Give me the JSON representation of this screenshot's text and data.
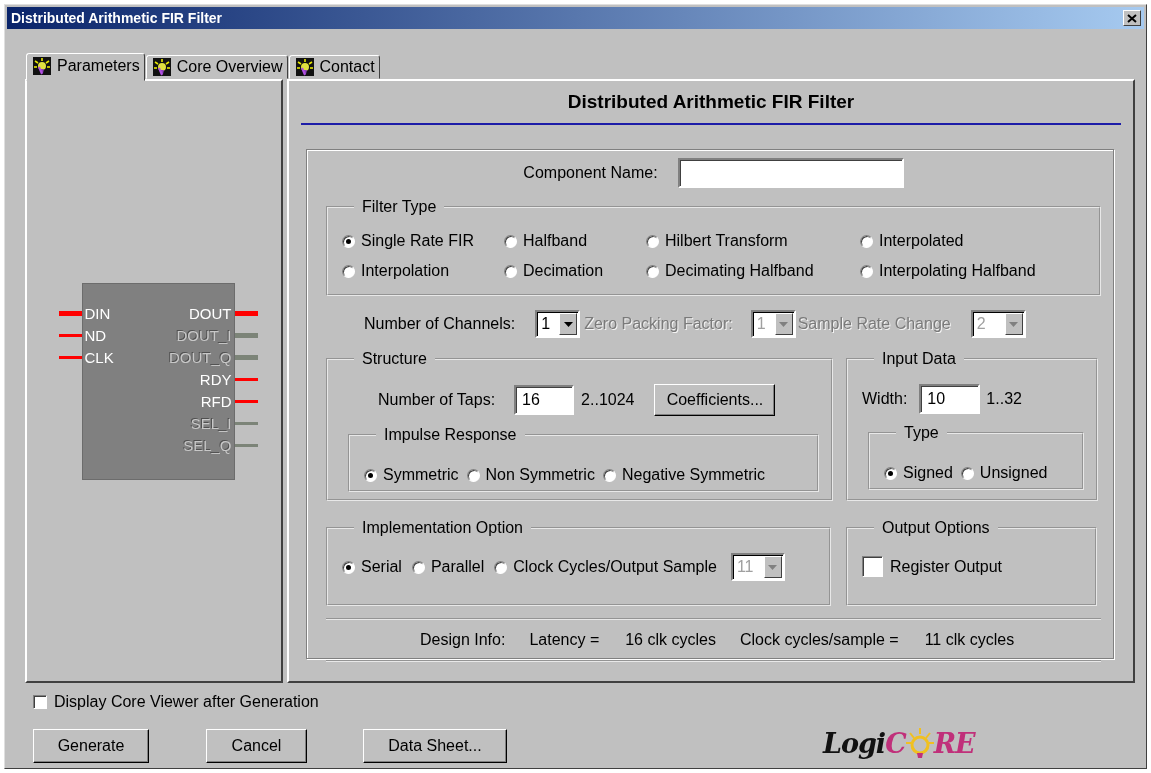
{
  "window": {
    "title": "Distributed Arithmetic FIR Filter"
  },
  "tabs": [
    {
      "label": "Parameters",
      "selected": true
    },
    {
      "label": "Core Overview",
      "selected": false
    },
    {
      "label": "Contact",
      "selected": false
    }
  ],
  "symbol": {
    "inputs": [
      {
        "name": "DIN",
        "enabled": true,
        "bus": true
      },
      {
        "name": "ND",
        "enabled": true,
        "bus": false
      },
      {
        "name": "CLK",
        "enabled": true,
        "bus": false
      }
    ],
    "outputs": [
      {
        "name": "DOUT",
        "enabled": true,
        "bus": true
      },
      {
        "name": "DOUT_I",
        "enabled": false,
        "bus": true
      },
      {
        "name": "DOUT_Q",
        "enabled": false,
        "bus": true
      },
      {
        "name": "RDY",
        "enabled": true,
        "bus": false
      },
      {
        "name": "RFD",
        "enabled": true,
        "bus": false
      },
      {
        "name": "SEL_I",
        "enabled": false,
        "bus": false
      },
      {
        "name": "SEL_Q",
        "enabled": false,
        "bus": false
      }
    ]
  },
  "panel_title": "Distributed Arithmetic FIR Filter",
  "component_name": {
    "label": "Component Name:"
  },
  "filter_type": {
    "legend": "Filter Type",
    "options": [
      {
        "label": "Single Rate FIR",
        "selected": true
      },
      {
        "label": "Halfband",
        "selected": false
      },
      {
        "label": "Hilbert Transform",
        "selected": false
      },
      {
        "label": "Interpolated",
        "selected": false
      },
      {
        "label": "Interpolation",
        "selected": false
      },
      {
        "label": "Decimation",
        "selected": false
      },
      {
        "label": "Decimating Halfband",
        "selected": false
      },
      {
        "label": "Interpolating Halfband",
        "selected": false
      }
    ]
  },
  "channels": {
    "label": "Number of Channels:",
    "value": "1",
    "disabled": false
  },
  "zero_packing": {
    "label": "Zero Packing Factor:",
    "value": "1",
    "disabled": true
  },
  "sample_rate_change": {
    "label": "Sample Rate Change",
    "value": "2",
    "disabled": true
  },
  "structure": {
    "legend": "Structure",
    "taps_label": "Number of Taps:",
    "taps_value": "16",
    "taps_range": "2..1024",
    "coefficients_button": "Coefficients...",
    "impulse_response": {
      "legend": "Impulse Response",
      "options": [
        {
          "label": "Symmetric",
          "selected": true
        },
        {
          "label": "Non Symmetric",
          "selected": false
        },
        {
          "label": "Negative Symmetric",
          "selected": false
        }
      ]
    }
  },
  "input_data": {
    "legend": "Input Data",
    "width_label": "Width:",
    "width_value": "10",
    "width_range": "1..32",
    "type": {
      "legend": "Type",
      "options": [
        {
          "label": "Signed",
          "selected": true
        },
        {
          "label": "Unsigned",
          "selected": false
        }
      ]
    }
  },
  "implementation": {
    "legend": "Implementation Option",
    "options": [
      {
        "label": "Serial",
        "selected": true
      },
      {
        "label": "Parallel",
        "selected": false
      },
      {
        "label": "Clock Cycles/Output Sample",
        "selected": false
      }
    ],
    "cycles": {
      "value": "11",
      "disabled": true
    }
  },
  "output_options": {
    "legend": "Output Options",
    "register_output": {
      "label": "Register Output",
      "checked": false
    }
  },
  "design_info": [
    "Design Info:",
    "Latency =",
    "16 clk cycles",
    "Clock cycles/sample =",
    "11 clk cycles"
  ],
  "display_viewer": {
    "label": "Display Core Viewer after Generation",
    "checked": false
  },
  "buttons": [
    "Generate",
    "Cancel",
    "Data Sheet..."
  ],
  "logo": {
    "dark": "Logi",
    "bright_before": "C",
    "bright_after": "RE"
  }
}
